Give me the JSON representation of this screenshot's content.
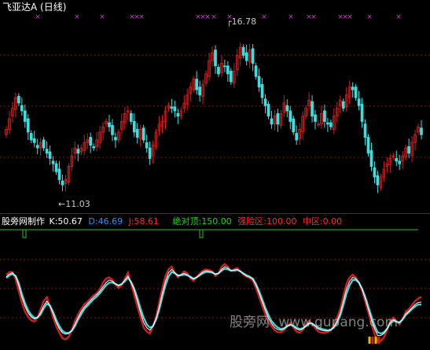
{
  "header": {
    "title": "飞亚达A (日线)"
  },
  "colors": {
    "up": "#d01f1f",
    "down": "#3fdede",
    "marker": "#d43dd4",
    "grid": "#8a1414",
    "text_white": "#ffffff",
    "text_red": "#ff2a2a",
    "text_green": "#19d619",
    "text_cyan": "#3fdede",
    "text_blue": "#3a8ef0",
    "hline": "#2dbf2d",
    "k_line": "#ffffff",
    "d_line": "#3fdede",
    "j_line": "#d01f1f",
    "label_gray": "#c8c8c8"
  },
  "price_panel": {
    "high_label": "16.78",
    "low_label": "11.03",
    "arrow_glyph": "←"
  },
  "indicator_panel": {
    "name": "股旁网制作",
    "k": {
      "label": "K:50.67"
    },
    "d": {
      "label": "D:46.69"
    },
    "j": {
      "label": "J:58.61"
    },
    "top": {
      "label": "绝对顶:150.00"
    },
    "danger": {
      "label": "强险区:100.00"
    },
    "mid": {
      "label": "中区:0.00"
    }
  },
  "watermark": {
    "cn": "股旁网",
    "url": "www.gupang.com"
  },
  "chart_data": [
    {
      "type": "candlestick",
      "title": "飞亚达A (日线)",
      "annotations": [
        {
          "text": "16.78",
          "value": 16.78,
          "kind": "high"
        },
        {
          "text": "11.03",
          "value": 11.03,
          "kind": "low"
        }
      ],
      "ylim": [
        10.4,
        17.3
      ],
      "grid": true,
      "closes": [
        13.3,
        13.7,
        14.1,
        14.5,
        14.3,
        14.0,
        13.6,
        13.2,
        12.9,
        12.8,
        12.6,
        12.8,
        12.6,
        12.4,
        12.2,
        12.0,
        11.7,
        11.4,
        11.2,
        11.4,
        11.9,
        12.3,
        12.6,
        12.4,
        12.6,
        12.8,
        12.9,
        12.7,
        12.6,
        12.9,
        13.2,
        13.4,
        13.6,
        13.4,
        13.1,
        12.9,
        13.2,
        13.6,
        13.9,
        14.0,
        13.6,
        13.2,
        13.0,
        13.3,
        12.9,
        12.6,
        12.2,
        12.7,
        13.2,
        13.5,
        13.6,
        14.0,
        14.2,
        14.1,
        14.0,
        13.8,
        14.0,
        14.3,
        14.6,
        14.9,
        15.2,
        14.8,
        14.6,
        15.0,
        15.4,
        15.9,
        16.2,
        15.7,
        15.4,
        15.8,
        15.7,
        15.4,
        15.1,
        15.5,
        16.1,
        16.4,
        16.1,
        15.9,
        16.3,
        15.8,
        15.3,
        14.9,
        14.5,
        14.2,
        13.8,
        13.5,
        13.8,
        13.5,
        13.9,
        14.3,
        14.0,
        13.6,
        13.2,
        12.9,
        13.3,
        13.8,
        14.1,
        14.4,
        13.8,
        13.6,
        13.5,
        13.9,
        13.6,
        13.5,
        13.4,
        13.8,
        14.1,
        14.4,
        14.1,
        14.6,
        14.9,
        14.8,
        14.5,
        14.2,
        13.6,
        13.0,
        12.4,
        11.9,
        11.5,
        11.2,
        11.5,
        11.8,
        12.0,
        12.2,
        12.3,
        12.1,
        12.0,
        12.3,
        12.6,
        12.4,
        12.8,
        13.1,
        13.4,
        13.1
      ],
      "bar_colors_rule": "close >= open ? up : down"
    },
    {
      "type": "line",
      "title": "股旁网制作",
      "series": [
        {
          "name": "K",
          "latest": 50.67
        },
        {
          "name": "D",
          "latest": 46.69
        },
        {
          "name": "J",
          "latest": 58.61
        }
      ],
      "reference_lines": [
        {
          "name": "绝对顶",
          "value": 150.0
        },
        {
          "name": "强险区",
          "value": 100.0
        },
        {
          "name": "中区",
          "value": 0.0
        }
      ],
      "ylim": [
        -10,
        160
      ],
      "K": [
        89,
        93,
        95,
        90,
        75,
        58,
        44,
        34,
        28,
        25,
        27,
        35,
        45,
        52,
        45,
        33,
        20,
        10,
        4,
        2,
        3,
        8,
        17,
        27,
        36,
        43,
        48,
        53,
        58,
        62,
        67,
        74,
        80,
        84,
        82,
        78,
        75,
        78,
        84,
        90,
        80,
        68,
        52,
        35,
        20,
        12,
        8,
        14,
        26,
        43,
        64,
        82,
        95,
        100,
        95,
        90,
        92,
        94,
        92,
        88,
        85,
        88,
        92,
        96,
        98,
        97,
        96,
        92,
        94,
        100,
        104,
        102,
        98,
        99,
        100,
        97,
        93,
        90,
        88,
        85,
        76,
        64,
        51,
        38,
        26,
        18,
        12,
        9,
        8,
        10,
        14,
        17,
        14,
        10,
        8,
        10,
        15,
        19,
        18,
        14,
        10,
        8,
        7,
        7,
        8,
        13,
        22,
        34,
        52,
        70,
        82,
        88,
        86,
        80,
        70,
        56,
        40,
        24,
        10,
        0,
        0,
        3,
        10,
        20,
        24,
        21,
        19,
        25,
        33,
        37,
        42,
        47,
        50,
        50.67
      ],
      "D": [
        87,
        91,
        93,
        90,
        79,
        63,
        49,
        38,
        31,
        27,
        27,
        32,
        41,
        48,
        45,
        36,
        24,
        14,
        7,
        4,
        4,
        7,
        14,
        24,
        32,
        40,
        45,
        50,
        55,
        59,
        64,
        70,
        76,
        80,
        80,
        78,
        76,
        78,
        82,
        87,
        81,
        71,
        57,
        41,
        27,
        17,
        12,
        14,
        24,
        39,
        58,
        76,
        89,
        96,
        94,
        91,
        91,
        92,
        91,
        89,
        86,
        88,
        91,
        94,
        96,
        96,
        95,
        93,
        94,
        98,
        101,
        100,
        98,
        98,
        99,
        97,
        94,
        91,
        89,
        86,
        78,
        67,
        55,
        42,
        31,
        22,
        16,
        12,
        10,
        11,
        14,
        16,
        15,
        12,
        10,
        11,
        14,
        18,
        18,
        15,
        12,
        10,
        9,
        8,
        9,
        12,
        19,
        30,
        46,
        63,
        76,
        84,
        84,
        80,
        71,
        59,
        44,
        29,
        15,
        5,
        3,
        5,
        10,
        18,
        22,
        21,
        20,
        24,
        31,
        35,
        40,
        44,
        47,
        46.69
      ],
      "J": [
        92,
        96,
        96,
        85,
        67,
        50,
        36,
        28,
        23,
        21,
        27,
        40,
        52,
        58,
        44,
        28,
        14,
        4,
        -4,
        -6,
        -2,
        8,
        22,
        32,
        40,
        47,
        51,
        56,
        61,
        64,
        70,
        80,
        86,
        88,
        84,
        77,
        72,
        76,
        86,
        95,
        78,
        61,
        44,
        28,
        12,
        6,
        3,
        14,
        28,
        50,
        72,
        90,
        100,
        104,
        95,
        88,
        92,
        97,
        94,
        86,
        83,
        88,
        94,
        98,
        100,
        99,
        97,
        90,
        94,
        104,
        108,
        104,
        98,
        100,
        102,
        97,
        92,
        89,
        87,
        83,
        72,
        58,
        45,
        32,
        20,
        14,
        8,
        5,
        5,
        8,
        14,
        19,
        12,
        6,
        4,
        8,
        16,
        22,
        18,
        11,
        6,
        4,
        4,
        5,
        8,
        16,
        27,
        40,
        60,
        78,
        88,
        92,
        88,
        80,
        68,
        52,
        35,
        18,
        2,
        -9,
        -8,
        -3,
        8,
        22,
        27,
        22,
        17,
        25,
        36,
        40,
        46,
        52,
        56,
        58.61
      ]
    }
  ]
}
